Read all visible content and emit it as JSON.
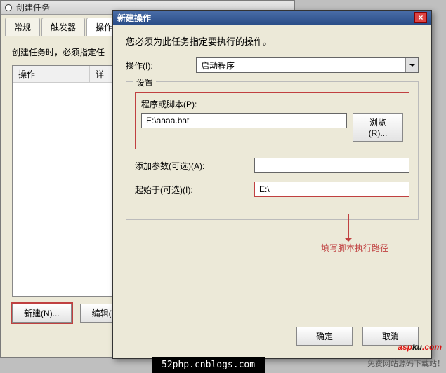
{
  "back": {
    "title": "创建任务",
    "tabs": [
      "常规",
      "触发器",
      "操作"
    ],
    "active_tab_index": 2,
    "msg": "创建任务时，必须指定任",
    "list_header_col1": "操作",
    "list_header_col2": "详",
    "btn_new": "新建(N)...",
    "btn_edit": "编辑("
  },
  "front": {
    "title": "新建操作",
    "prompt": "您必须为此任务指定要执行的操作。",
    "action_label": "操作(I):",
    "action_value": "启动程序",
    "settings_legend": "设置",
    "script_label": "程序或脚本(P):",
    "script_value": "E:\\aaaa.bat",
    "browse": "浏览(R)...",
    "args_label": "添加参数(可选)(A):",
    "args_value": "",
    "startin_label": "起始于(可选)(I):",
    "startin_value": "E:\\",
    "hint": "填写脚本执行路径",
    "ok": "确定",
    "cancel": "取消"
  },
  "overlay": {
    "blog": "52php.cnblogs.com",
    "wm1_part1": "asp",
    "wm1_part2": "ku",
    "wm1_part3": ".com",
    "wm2": "免费网站源码下载站！"
  }
}
